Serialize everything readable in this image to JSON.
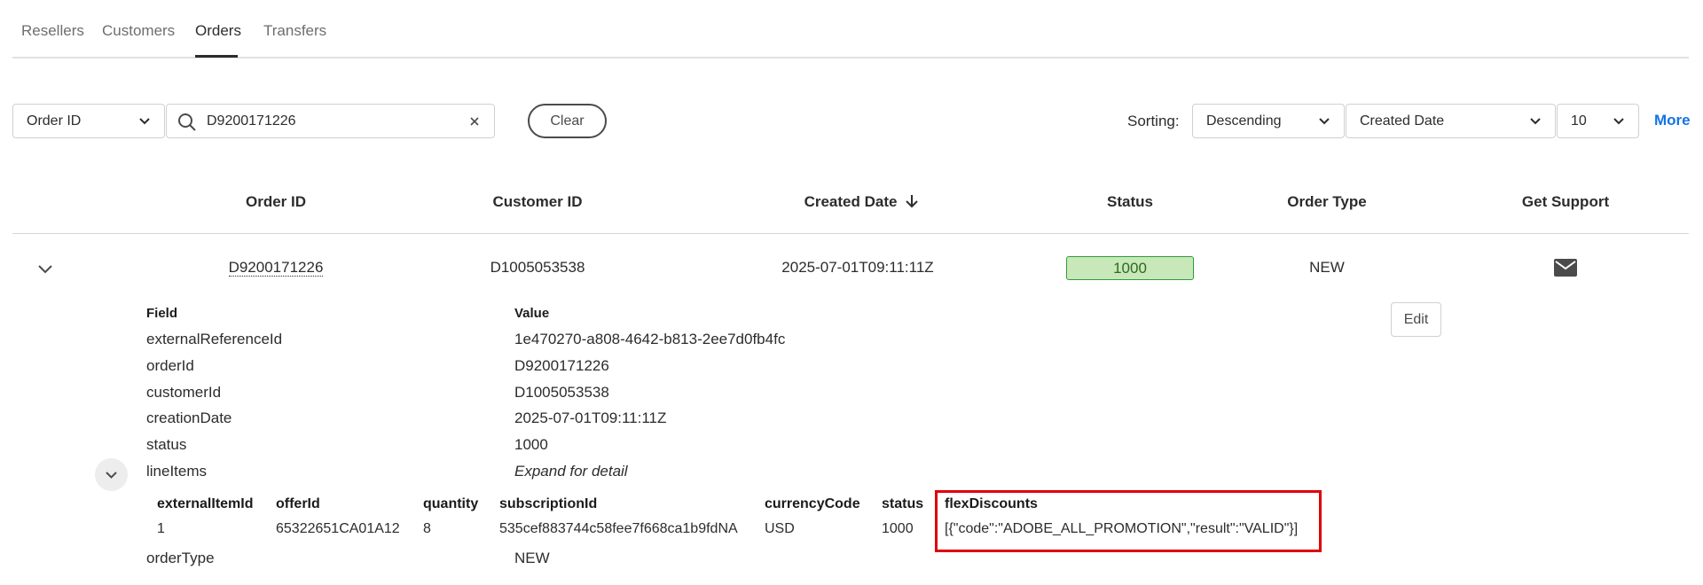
{
  "tabs": [
    {
      "label": "Resellers"
    },
    {
      "label": "Customers"
    },
    {
      "label": "Orders"
    },
    {
      "label": "Transfers"
    }
  ],
  "active_tab": "Orders",
  "toolbar": {
    "search_field": "Order ID",
    "search_value": "D9200171226",
    "clear_label": "Clear",
    "sorting_label": "Sorting:",
    "sort_order": "Descending",
    "sort_field": "Created Date",
    "page_size": "10",
    "more_label": "More"
  },
  "table": {
    "columns": [
      "Order ID",
      "Customer ID",
      "Created Date",
      "Status",
      "Order Type",
      "Get Support"
    ],
    "sorted_column": "Created Date",
    "sort_direction": "descending",
    "rows": [
      {
        "order_id": "D9200171226",
        "customer_id": "D1005053538",
        "created_date": "2025-07-01T09:11:11Z",
        "status": "1000",
        "order_type": "NEW"
      }
    ]
  },
  "detail": {
    "field_header": "Field",
    "value_header": "Value",
    "edit_label": "Edit",
    "fields": [
      {
        "field": "externalReferenceId",
        "value": "1e470270-a808-4642-b813-2ee7d0fb4fc"
      },
      {
        "field": "orderId",
        "value": "D9200171226"
      },
      {
        "field": "customerId",
        "value": "D1005053538"
      },
      {
        "field": "creationDate",
        "value": "2025-07-01T09:11:11Z"
      },
      {
        "field": "status",
        "value": "1000"
      },
      {
        "field": "lineItems",
        "value": "Expand for detail"
      }
    ],
    "order_type_field": {
      "field": "orderType",
      "value": "NEW"
    }
  },
  "line_items": {
    "columns": [
      "externalItemId",
      "offerId",
      "quantity",
      "subscriptionId",
      "currencyCode",
      "status",
      "flexDiscounts"
    ],
    "rows": [
      {
        "externalItemId": "1",
        "offerId": "65322651CA01A12",
        "quantity": "8",
        "subscriptionId": "535cef883744c58fee7f668ca1b9fdNA",
        "currencyCode": "USD",
        "status": "1000",
        "flexDiscounts": "[{\"code\":\"ADOBE_ALL_PROMOTION\",\"result\":\"VALID\"}]"
      }
    ]
  },
  "colors": {
    "accent": "#1473e6",
    "status_badge_bg": "#c8e8b9",
    "status_badge_border": "#2d9d3a",
    "highlight": "#e0000e"
  }
}
